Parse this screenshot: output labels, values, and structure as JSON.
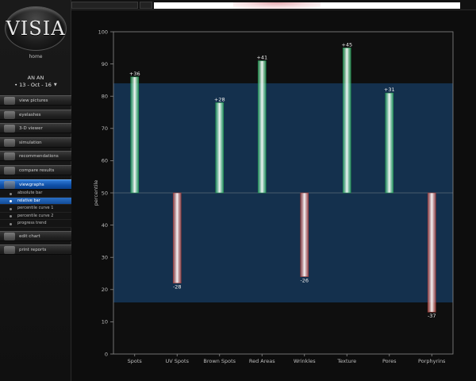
{
  "app": {
    "logo": "VISIA",
    "home_link": "home"
  },
  "patient": {
    "name": "AN AN",
    "date": "• 13 - Oct - 16"
  },
  "menu": {
    "items": [
      {
        "label": "view pictures",
        "icon": "view-pictures-icon"
      },
      {
        "label": "eyelashes",
        "icon": "eyelashes-icon"
      },
      {
        "label": "3-D viewer",
        "icon": "3d-viewer-icon"
      },
      {
        "label": "simulation",
        "icon": "simulation-icon"
      },
      {
        "label": "recommendations",
        "icon": "recommendations-icon"
      },
      {
        "label": "compare results",
        "icon": "compare-results-icon"
      },
      {
        "label": "viewgraphs",
        "icon": "viewgraphs-icon",
        "active": true
      },
      {
        "label": "edit chart",
        "icon": "edit-chart-icon"
      },
      {
        "label": "print reports",
        "icon": "print-reports-icon"
      }
    ],
    "graph_options": [
      {
        "label": "absolute bar"
      },
      {
        "label": "relative bar",
        "active": true
      },
      {
        "label": "percentile curve 1"
      },
      {
        "label": "percentile curve 2"
      },
      {
        "label": "progress trend"
      }
    ]
  },
  "colors": {
    "positive_bar": "#3ccf7a",
    "negative_bar": "#e0605a",
    "band": "#14304d",
    "plot_bg": "#0f0f0f",
    "active_menu": "#1f63bd"
  },
  "chart_data": {
    "type": "bar",
    "categories": [
      "Spots",
      "UV Spots",
      "Brown Spots",
      "Red Areas",
      "Wrinkles",
      "Texture",
      "Pores",
      "Porphyrins"
    ],
    "values": [
      86,
      22,
      78,
      91,
      24,
      95,
      81,
      13
    ],
    "data_labels": [
      "+36",
      "-28",
      "+28",
      "+41",
      "-26",
      "+45",
      "+31",
      "-37"
    ],
    "baseline": 50,
    "band": [
      16,
      84
    ],
    "title": "",
    "xlabel": "",
    "ylabel": "percentile",
    "ylim": [
      0,
      100
    ],
    "yticks": [
      0,
      10,
      20,
      30,
      40,
      50,
      60,
      70,
      80,
      90,
      100
    ],
    "grid": false
  }
}
